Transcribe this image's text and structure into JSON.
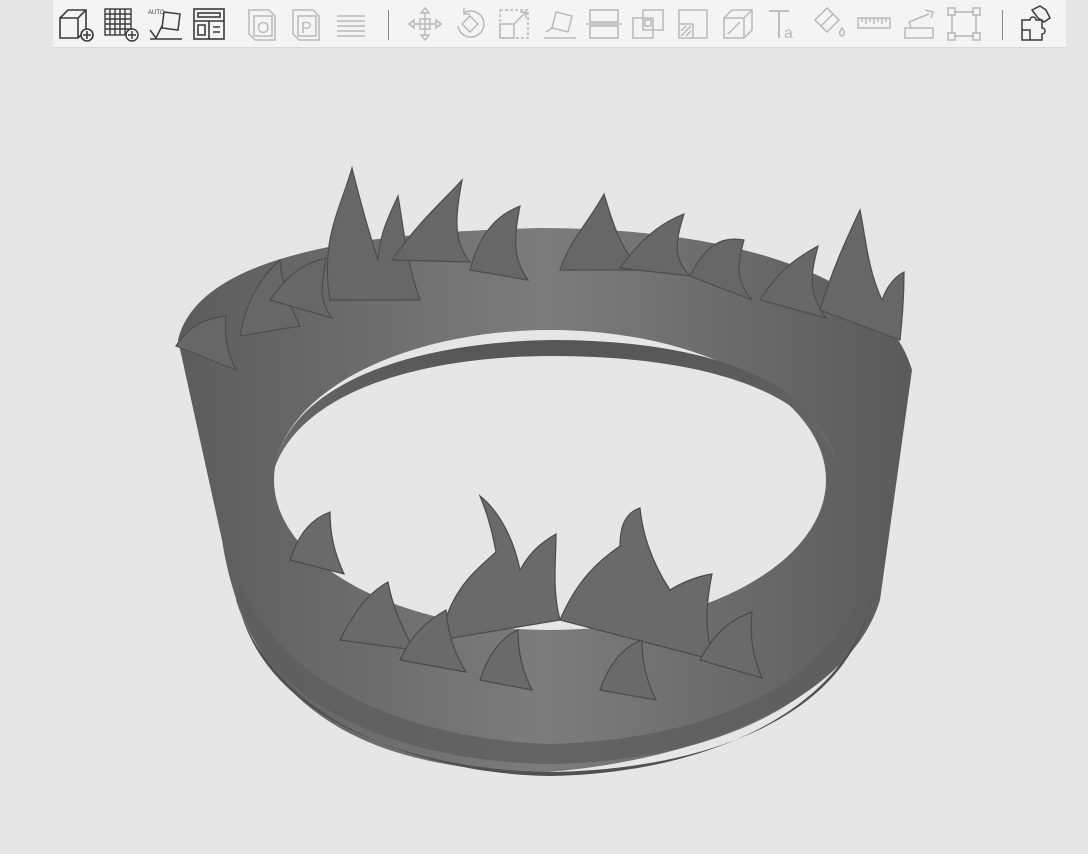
{
  "app": {
    "viewport_background": "#e6e6e6",
    "model_color": "#6d6d6d"
  },
  "toolbar": {
    "tools": [
      {
        "icon": "add-model-icon",
        "enabled": true
      },
      {
        "icon": "add-grid-array-icon",
        "enabled": true
      },
      {
        "icon": "auto-arrange-icon",
        "enabled": true,
        "label": "AUTO"
      },
      {
        "icon": "layout-panels-icon",
        "enabled": true
      },
      {
        "icon": "object-mode-icon",
        "enabled": false,
        "label": "O"
      },
      {
        "icon": "part-mode-icon",
        "enabled": false,
        "label": "P"
      },
      {
        "icon": "layers-icon",
        "enabled": false
      },
      {
        "icon": "move-icon",
        "enabled": false
      },
      {
        "icon": "rotate-icon",
        "enabled": false
      },
      {
        "icon": "scale-icon",
        "enabled": false
      },
      {
        "icon": "lay-flat-icon",
        "enabled": false
      },
      {
        "icon": "cut-icon",
        "enabled": false
      },
      {
        "icon": "support-paint-icon",
        "enabled": false
      },
      {
        "icon": "seam-paint-icon",
        "enabled": false
      },
      {
        "icon": "hollow-icon",
        "enabled": false
      },
      {
        "icon": "text-emboss-icon",
        "enabled": false,
        "label": "a"
      },
      {
        "icon": "color-paint-icon",
        "enabled": false
      },
      {
        "icon": "measure-icon",
        "enabled": false
      },
      {
        "icon": "assembly-icon",
        "enabled": false
      },
      {
        "icon": "fit-view-icon",
        "enabled": false
      },
      {
        "icon": "split-parts-icon",
        "enabled": true
      }
    ]
  }
}
